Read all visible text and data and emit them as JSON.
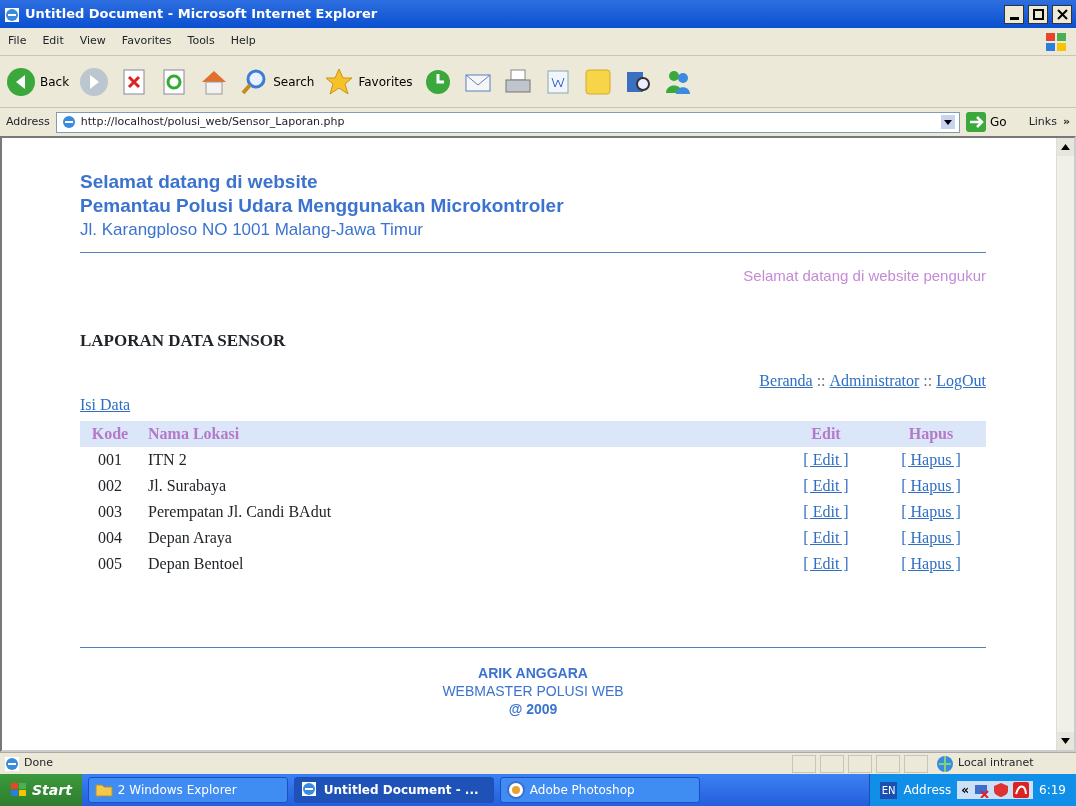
{
  "window": {
    "title": "Untitled Document - Microsoft Internet Explorer"
  },
  "menu": [
    "File",
    "Edit",
    "View",
    "Favorites",
    "Tools",
    "Help"
  ],
  "toolbar": [
    {
      "kind": "back",
      "label": "Back"
    },
    {
      "kind": "forward"
    },
    {
      "kind": "stop"
    },
    {
      "kind": "refresh"
    },
    {
      "kind": "home"
    },
    {
      "kind": "search",
      "label": "Search"
    },
    {
      "kind": "favorites",
      "label": "Favorites"
    },
    {
      "kind": "history"
    },
    {
      "kind": "mail"
    },
    {
      "kind": "print"
    },
    {
      "kind": "word"
    },
    {
      "kind": "note"
    },
    {
      "kind": "research"
    },
    {
      "kind": "messenger"
    }
  ],
  "address_bar": {
    "label": "Address",
    "url": "http://localhost/polusi_web/Sensor_Laporan.php",
    "go": "Go",
    "links": "Links",
    "more": "»"
  },
  "page": {
    "header": [
      "Selamat datang di website",
      "Pemantau Polusi Udara Menggunakan Microkontroler",
      "Jl. Karangploso NO 1001 Malang-Jawa Timur"
    ],
    "welcome": "Selamat datang di website pengukur",
    "section_title": "LAPORAN DATA SENSOR",
    "nav": [
      {
        "kind": "link",
        "text": "Beranda"
      },
      {
        "kind": "sep",
        "text": "::"
      },
      {
        "kind": "link",
        "text": "Administrator"
      },
      {
        "kind": "sep",
        "text": "::"
      },
      {
        "kind": "link",
        "text": "LogOut"
      }
    ],
    "add_link": "Isi Data",
    "table": {
      "columns": [
        "Kode",
        "Nama Lokasi",
        "Edit",
        "Hapus"
      ],
      "rows": [
        {
          "kode": "001",
          "lokasi": "ITN 2",
          "edit": "[ Edit ]",
          "hapus": "[ Hapus ]"
        },
        {
          "kode": "002",
          "lokasi": "Jl. Surabaya",
          "edit": "[ Edit ]",
          "hapus": "[ Hapus ]"
        },
        {
          "kode": "003",
          "lokasi": "Perempatan Jl. Candi BAdut",
          "edit": "[ Edit ]",
          "hapus": "[ Hapus ]"
        },
        {
          "kode": "004",
          "lokasi": "Depan Araya",
          "edit": "[ Edit ]",
          "hapus": "[ Hapus ]"
        },
        {
          "kode": "005",
          "lokasi": "Depan Bentoel",
          "edit": "[ Edit ]",
          "hapus": "[ Hapus ]"
        }
      ]
    },
    "footer": [
      "ARIK ANGGARA",
      "WEBMASTER POLUSI WEB",
      "@ 2009"
    ]
  },
  "status_bar": {
    "text": "Done",
    "zone": "Local intranet"
  },
  "taskbar": {
    "start": "Start",
    "tasks": [
      {
        "label": "2 Windows Explorer",
        "selected": false,
        "kind": "folder"
      },
      {
        "label": "Untitled Document - ...",
        "selected": true,
        "kind": "ie"
      },
      {
        "label": "Adobe Photoshop",
        "selected": false,
        "kind": "photoshop"
      }
    ],
    "language": "EN",
    "address": "Address",
    "chevron": "«",
    "time": "6:19"
  }
}
